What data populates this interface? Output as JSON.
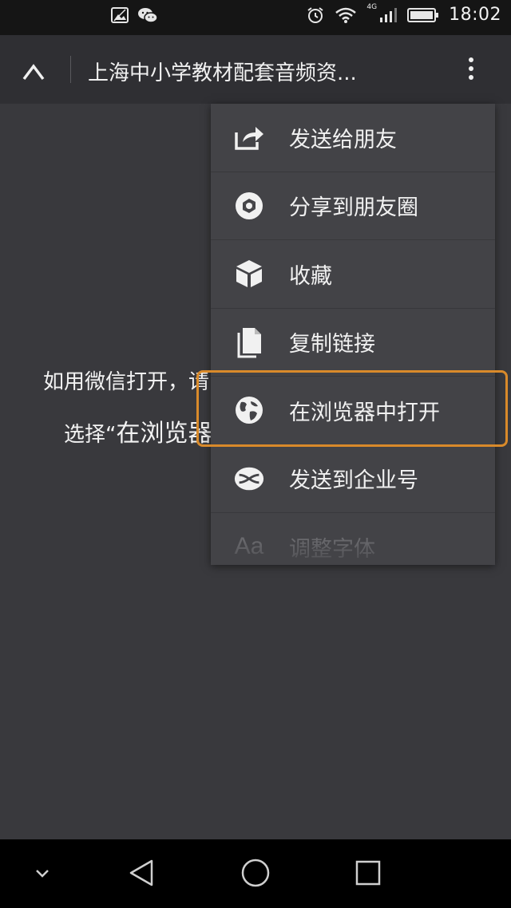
{
  "status_bar": {
    "time": "18:02",
    "network": "4G",
    "icons": [
      "gallery-icon",
      "wechat-icon",
      "alarm-icon",
      "wifi-icon",
      "signal-icon",
      "battery-icon"
    ]
  },
  "header": {
    "title": "上海中小学教材配套音频资...",
    "close_icon": "close-icon",
    "more_icon": "more-vertical-icon"
  },
  "content": {
    "line1": "如用微信打开，请",
    "line2_prefix": "选择“",
    "line2_big": "在浏览器"
  },
  "menu": {
    "items": [
      {
        "label": "发送给朋友",
        "icon": "share-icon"
      },
      {
        "label": "分享到朋友圈",
        "icon": "moments-icon"
      },
      {
        "label": "收藏",
        "icon": "favorite-cube-icon"
      },
      {
        "label": "复制链接",
        "icon": "copy-link-icon"
      },
      {
        "label": "在浏览器中打开",
        "icon": "globe-icon"
      },
      {
        "label": "发送到企业号",
        "icon": "enterprise-icon"
      },
      {
        "label": "调整字体",
        "icon": "font-size-icon",
        "icon_text": "Aa"
      }
    ],
    "highlighted_index": 4
  },
  "nav_bar": {
    "icons": [
      "hide-nav-icon",
      "back-icon",
      "home-icon",
      "recents-icon"
    ]
  },
  "colors": {
    "status_bg": "#151515",
    "header_bg": "#2f2f33",
    "content_bg": "#39393d",
    "menu_bg": "#434347",
    "highlight": "#d98a2a"
  }
}
